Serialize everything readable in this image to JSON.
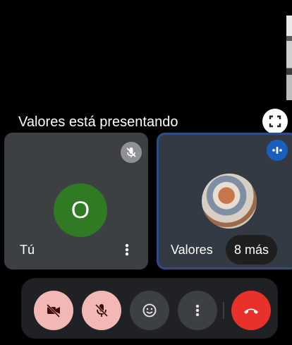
{
  "presentation": {
    "label": "Valores está presentando",
    "fullscreen_icon": "fullscreen-icon"
  },
  "self_tile": {
    "name": "Tú",
    "initial": "O",
    "avatar_color": "#2f7a23",
    "mic_muted": true
  },
  "remote_tile": {
    "name": "Valores",
    "speaking": true
  },
  "participants_pill": {
    "label": "8 más"
  },
  "controls": {
    "camera": "camera-off-icon",
    "microphone": "mic-off-icon",
    "reactions": "emoji-icon",
    "more": "more-vert-icon",
    "end_call": "call-end-icon"
  },
  "colors": {
    "muted_control": "#f2b8b5",
    "end_call": "#e8312a",
    "speaking_highlight": "#1a5fbf"
  }
}
